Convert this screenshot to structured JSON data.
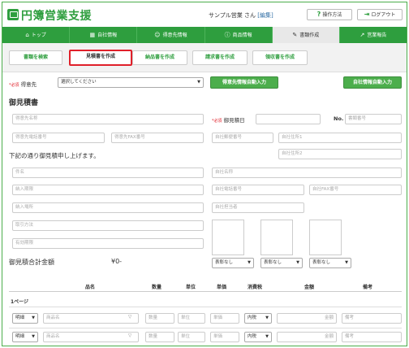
{
  "header": {
    "app_name": "円簿営業支援",
    "company_name": "サンプル営業",
    "san": "さん",
    "edit_link": "[編集]",
    "help_label": "操作方法",
    "logout_label": "ログアウト"
  },
  "nav": {
    "items": [
      {
        "label": "トップ",
        "icon": "⌂"
      },
      {
        "label": "自社情報",
        "icon": "▦"
      },
      {
        "label": "得意先情報",
        "icon": "☺"
      },
      {
        "label": "商品情報",
        "icon": "ⓘ"
      },
      {
        "label": "書類作成",
        "icon": "✎"
      },
      {
        "label": "営業報告",
        "icon": "↗"
      }
    ],
    "active_index": 4
  },
  "subtabs": [
    "書類を検索",
    "見積書を作成",
    "納品書を作成",
    "請求書を作成",
    "領収書を作成"
  ],
  "customer": {
    "required": "*必須",
    "label": "得意先",
    "select_value": "選択してください",
    "autofill_customer": "得意先情報自動入力",
    "autofill_self": "自社情報自動入力"
  },
  "form": {
    "title": "御見積書",
    "customer_name_ph": "得意先名称",
    "quote_date_required": "*必須",
    "quote_date_label": "御見積日",
    "no_label": "No.",
    "doc_no_ph": "書類番号",
    "customer_tel_ph": "得意先電話番号",
    "customer_fax_ph": "得意先FAX番号",
    "self_zip_ph": "自社郵便番号",
    "self_addr1_ph": "自社住所1",
    "self_addr2_ph": "自社住所2",
    "message": "下記の通り御見積申し上げます。",
    "subject_ph": "件名",
    "self_name_ph": "自社名称",
    "delivery_date_ph": "納入期限",
    "self_tel_ph": "自社電話番号",
    "self_fax_ph": "自社FAX番号",
    "delivery_place_ph": "納入場所",
    "self_staff_ph": "自社担当者",
    "terms_ph": "取引方法",
    "expiry_ph": "有効期限",
    "total_label": "御見積合計金額",
    "total_value": "¥0-",
    "stamp_select": "表彰なし"
  },
  "table": {
    "headers": [
      "品名",
      "数量",
      "単位",
      "単価",
      "消費税",
      "金額",
      "備考"
    ],
    "page_label": "1ページ",
    "rows": [
      {
        "type": "明細",
        "item_ph": "商品名",
        "qty_ph": "数量",
        "unit_ph": "単位",
        "price_ph": "単価",
        "tax": "内税",
        "amount_ph": "金額",
        "note_ph": "備考"
      },
      {
        "type": "明細",
        "item_ph": "商品名",
        "qty_ph": "数量",
        "unit_ph": "単位",
        "price_ph": "単価",
        "tax": "内税",
        "amount_ph": "金額",
        "note_ph": "備考"
      }
    ]
  },
  "colors": {
    "brand_green": "#2e9e3e",
    "active_tab_border": "#e0202a",
    "required_red": "#e0202a"
  }
}
